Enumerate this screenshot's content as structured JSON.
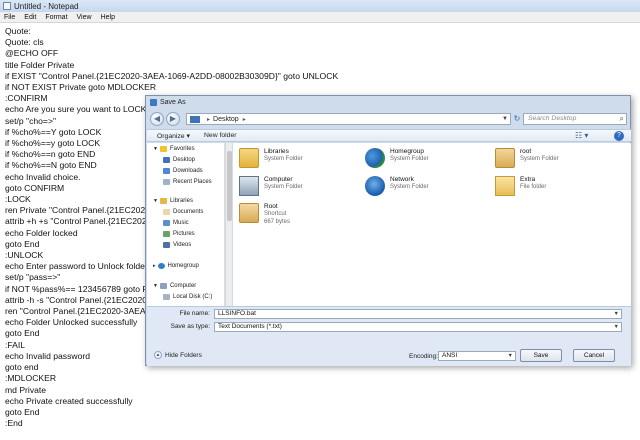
{
  "notepad": {
    "title": "Untitled - Notepad",
    "menu": [
      "File",
      "Edit",
      "Format",
      "View",
      "Help"
    ],
    "lines": [
      "Quote:",
      "Quote: cls",
      "@ECHO OFF",
      "title Folder Private",
      "if EXIST \"Control Panel.{21EC2020-3AEA-1069-A2DD-08002B30309D}\" goto UNLOCK",
      "if NOT EXIST Private goto MDLOCKER",
      ":CONFIRM",
      "echo Are you sure you want to LOCK the",
      "set/p \"cho=>\"",
      "if %cho%==Y goto LOCK",
      "if %cho%==y goto LOCK",
      "if %cho%==n goto END",
      "if %cho%==N goto END",
      "echo Invalid choice.",
      "goto CONFIRM",
      ":LOCK",
      "ren Private \"Control Panel.{21EC2020-3A",
      "attrib +h +s \"Control Panel.{21EC2020-3A",
      "echo Folder locked",
      "goto End",
      ":UNLOCK",
      "echo Enter password to Unlock folder",
      "set/p \"pass=>\"",
      "if NOT %pass%== 123456789 goto FAIL",
      "attrib -h -s \"Control Panel.{21EC2020-3A",
      "ren \"Control Panel.{21EC2020-3AEA-10",
      "echo Folder Unlocked successfully",
      "goto End",
      ":FAIL",
      "echo Invalid password",
      "goto end",
      ":MDLOCKER",
      "md Private",
      "echo Private created successfully",
      "goto End",
      ":End"
    ]
  },
  "dialog": {
    "title": "Save As",
    "address": "Desktop",
    "search_placeholder": "Search Desktop",
    "toolbar": {
      "organize": "Organize ▾",
      "new_folder": "New folder"
    },
    "nav": {
      "favorites": "Favorites",
      "desktop": "Desktop",
      "downloads": "Downloads",
      "recent_places": "Recent Places",
      "libraries": "Libraries",
      "documents": "Documents",
      "music": "Music",
      "pictures": "Pictures",
      "videos": "Videos",
      "homegroup": "Homegroup",
      "computer": "Computer",
      "local_disk": "Local Disk (C:)"
    },
    "files": [
      {
        "name": "Libraries",
        "type": "System Folder",
        "icon": "libraries-icon"
      },
      {
        "name": "Homegroup",
        "type": "System Folder",
        "icon": "homegroup-icon"
      },
      {
        "name": "root",
        "type": "System Folder",
        "icon": "user-folder-icon"
      },
      {
        "name": "Computer",
        "type": "System Folder",
        "icon": "computer-icon"
      },
      {
        "name": "Network",
        "type": "System Folder",
        "icon": "network-icon"
      },
      {
        "name": "Extra",
        "type": "File folder",
        "icon": "folder-icon"
      },
      {
        "name": "Root",
        "type": "Shortcut",
        "size": "667 bytes",
        "icon": "shortcut-icon"
      }
    ],
    "file_name_label": "File name:",
    "file_name_value": "LLSINFO.bat",
    "save_as_type_label": "Save as type:",
    "save_as_type_value": "Text Documents (*.txt)",
    "hide_folders": "Hide Folders",
    "encoding_label": "Encoding:",
    "encoding_value": "ANSI",
    "save_button": "Save",
    "cancel_button": "Cancel"
  }
}
